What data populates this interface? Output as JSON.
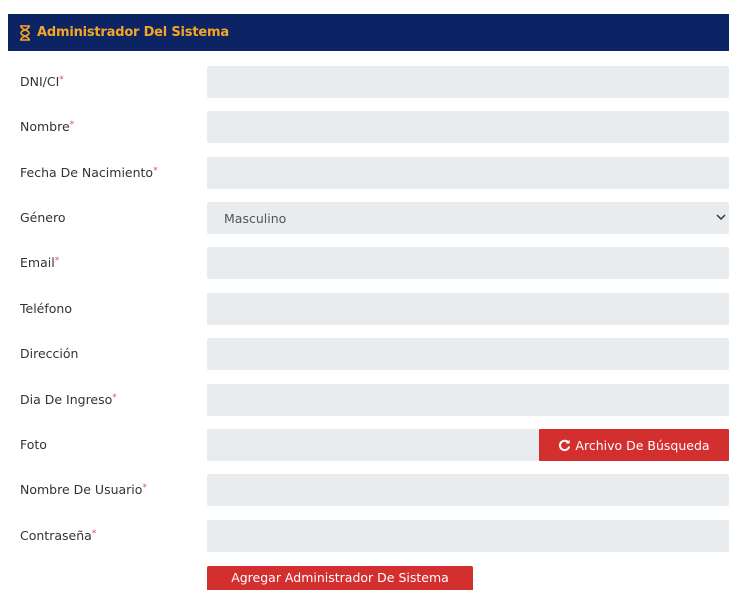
{
  "header": {
    "title": "Administrador Del Sistema",
    "icon": "hourglass-icon"
  },
  "form": {
    "fields": [
      {
        "label": "DNI/CI",
        "required": "*",
        "value": ""
      },
      {
        "label": "Nombre",
        "required": "*",
        "value": ""
      },
      {
        "label": "Fecha De Nacimiento",
        "required": "*",
        "value": ""
      },
      {
        "label": "Género",
        "required": "",
        "value": "Masculino"
      },
      {
        "label": "Email",
        "required": "*",
        "value": ""
      },
      {
        "label": "Teléfono",
        "required": "",
        "value": ""
      },
      {
        "label": "Dirección",
        "required": "",
        "value": ""
      },
      {
        "label": "Dia De Ingreso",
        "required": "*",
        "value": ""
      },
      {
        "label": "Foto",
        "required": "",
        "value": ""
      },
      {
        "label": "Nombre De Usuario",
        "required": "*",
        "value": ""
      },
      {
        "label": "Contraseña",
        "required": "*",
        "value": ""
      }
    ],
    "file_button_label": "Archivo De Búsqueda",
    "submit_label": "Agregar Administrador De Sistema"
  },
  "colors": {
    "header_bg": "#0d2464",
    "header_text": "#f5a623",
    "button_bg": "#d32f2f",
    "field_bg": "#e9ecef"
  }
}
